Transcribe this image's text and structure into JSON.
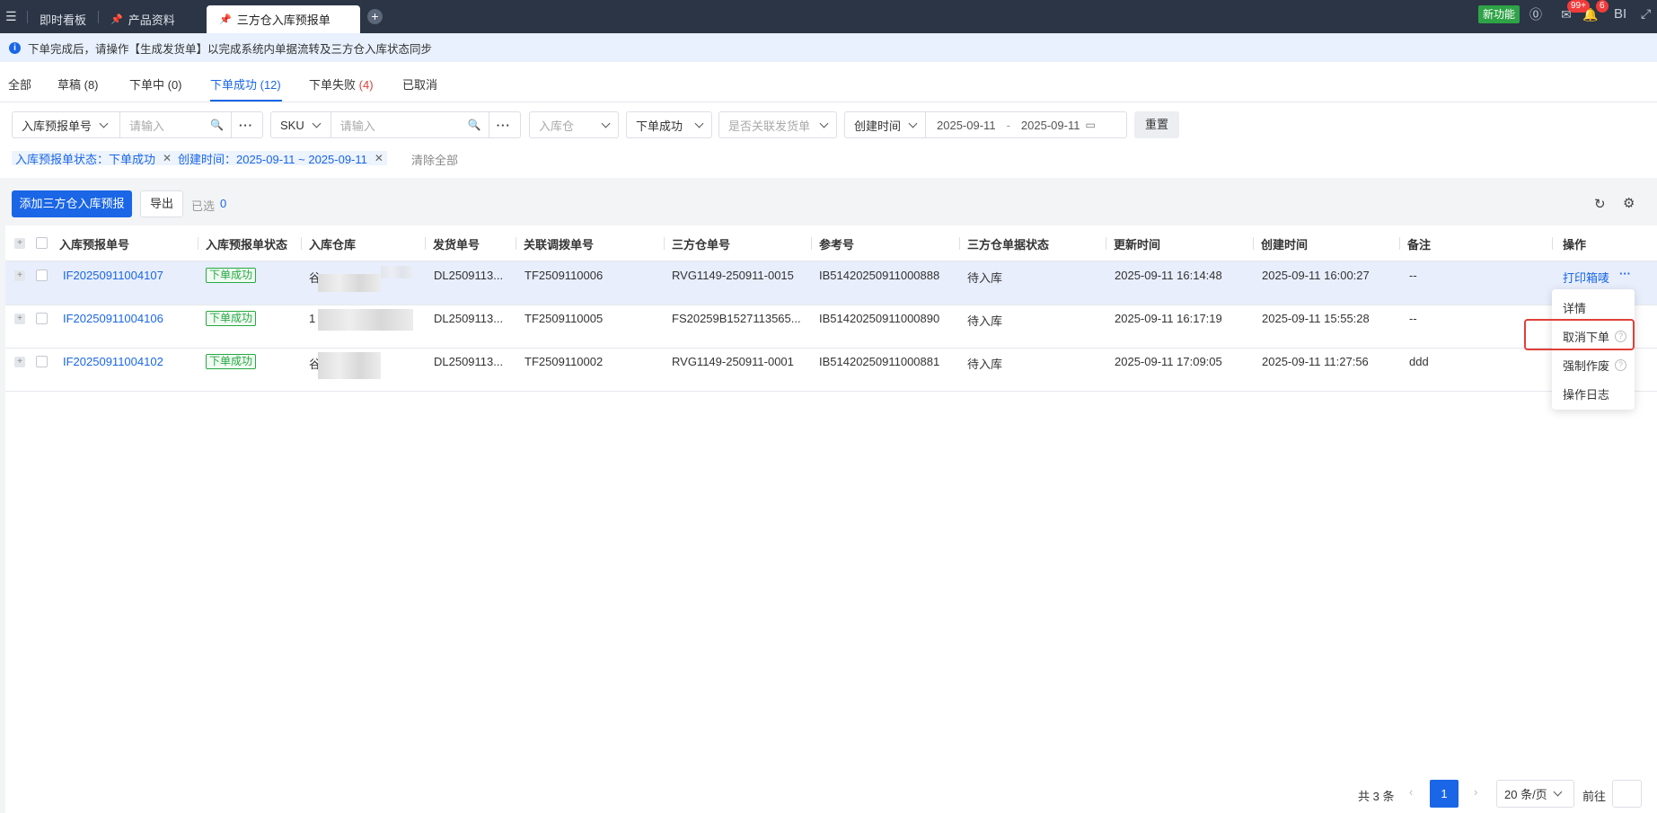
{
  "topbar": {
    "tabs": [
      {
        "label": "即时看板"
      },
      {
        "label": "产品资料"
      },
      {
        "label": "三方仓入库预报单"
      }
    ],
    "new_feature": "新功能",
    "badge_messages": "99+",
    "badge_notifications": "6",
    "user_initials": "BI"
  },
  "notice": {
    "text": "下单完成后，请操作【生成发货单】以完成系统内单据流转及三方仓入库状态同步"
  },
  "status_tabs": [
    {
      "label": "全部"
    },
    {
      "label": "草稿 (8)"
    },
    {
      "label": "下单中 (0)"
    },
    {
      "label": "下单成功 (12)"
    },
    {
      "label": "下单失败",
      "count": "(4)"
    },
    {
      "label": "已取消"
    }
  ],
  "filters": {
    "field1": "入库预报单号",
    "field1_placeholder": "请输入",
    "field2": "SKU",
    "field2_placeholder": "请输入",
    "warehouse_placeholder": "入库仓",
    "status_value": "下单成功",
    "link_placeholder": "是否关联发货单",
    "date_field": "创建时间",
    "date_start": "2025-09-11",
    "date_sep": "-",
    "date_end": "2025-09-11",
    "reset": "重置"
  },
  "active_tags": [
    {
      "label": "入库预报单状态：下单成功"
    },
    {
      "label": "创建时间：2025-09-11 ~ 2025-09-11"
    }
  ],
  "clear_all": "清除全部",
  "toolbar": {
    "add_button": "添加三方仓入库预报",
    "export_button": "导出",
    "selected_label": "已选",
    "selected_count": "0"
  },
  "table": {
    "headers": [
      "入库预报单号",
      "入库预报单状态",
      "入库仓库",
      "发货单号",
      "关联调拨单号",
      "三方仓单号",
      "参考号",
      "三方仓单据状态",
      "更新时间",
      "创建时间",
      "备注",
      "操作"
    ],
    "rows": [
      {
        "id": "IF20250911004107",
        "status": "下单成功",
        "warehouse": "谷",
        "ship_no": "DL2509113...",
        "transfer_no": "TF2509110006",
        "tp_no": "RVG1149-250911-0015",
        "ref_no": "IB51420250911000888",
        "tp_status": "待入库",
        "updated": "2025-09-11 16:14:48",
        "created": "2025-09-11 16:00:27",
        "remark": "--"
      },
      {
        "id": "IF20250911004106",
        "status": "下单成功",
        "warehouse": "1",
        "ship_no": "DL2509113...",
        "transfer_no": "TF2509110005",
        "tp_no": "FS20259B1527113565...",
        "ref_no": "IB51420250911000890",
        "tp_status": "待入库",
        "updated": "2025-09-11 16:17:19",
        "created": "2025-09-11 15:55:28",
        "remark": "--"
      },
      {
        "id": "IF20250911004102",
        "status": "下单成功",
        "warehouse": "谷",
        "ship_no": "DL2509113...",
        "transfer_no": "TF2509110002",
        "tp_no": "RVG1149-250911-0001",
        "ref_no": "IB51420250911000881",
        "tp_status": "待入库",
        "updated": "2025-09-11 17:09:05",
        "created": "2025-09-11 11:27:56",
        "remark": "ddd"
      }
    ],
    "row_action": "打印箱唛",
    "more_icon": "more-dots-icon"
  },
  "action_menu": {
    "items": [
      "详情",
      "取消下单",
      "强制作废",
      "操作日志"
    ]
  },
  "pagination": {
    "total": "共 3 条",
    "current_page": "1",
    "page_size": "20 条/页",
    "goto_label": "前往"
  },
  "colors": {
    "primary": "#1a66e6",
    "success": "#27a844",
    "danger": "#e0403a",
    "topbar": "#2b3545"
  }
}
